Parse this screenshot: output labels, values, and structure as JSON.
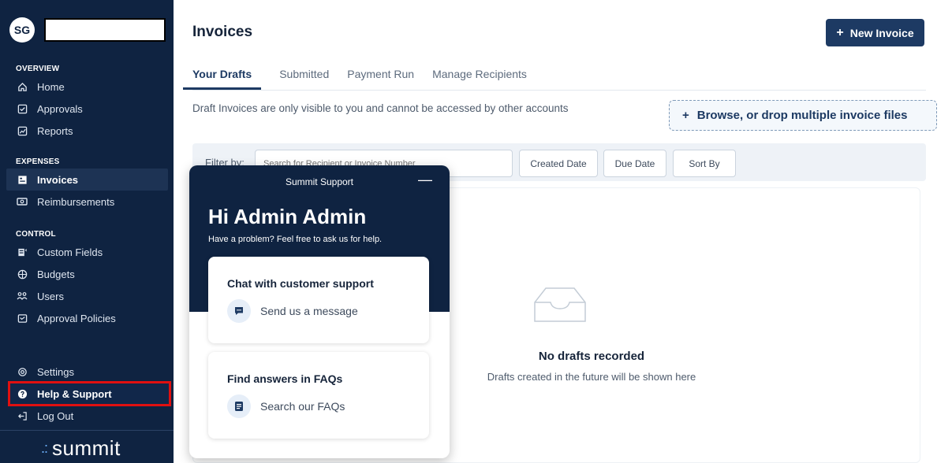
{
  "sidebar": {
    "avatar_initials": "SG",
    "sections": [
      {
        "heading": "OVERVIEW",
        "items": [
          {
            "label": "Home",
            "icon": "home-icon"
          },
          {
            "label": "Approvals",
            "icon": "check-square-icon"
          },
          {
            "label": "Reports",
            "icon": "chart-icon"
          }
        ]
      },
      {
        "heading": "EXPENSES",
        "items": [
          {
            "label": "Invoices",
            "icon": "invoice-icon"
          },
          {
            "label": "Reimbursements",
            "icon": "cash-icon"
          }
        ]
      },
      {
        "heading": "CONTROL",
        "items": [
          {
            "label": "Custom Fields",
            "icon": "fields-icon"
          },
          {
            "label": "Budgets",
            "icon": "budget-icon"
          },
          {
            "label": "Users",
            "icon": "users-icon"
          },
          {
            "label": "Approval Policies",
            "icon": "policy-icon"
          }
        ]
      }
    ],
    "bottom": {
      "settings": "Settings",
      "help": "Help & Support",
      "logout": "Log Out"
    },
    "logo_text": "summit"
  },
  "header": {
    "title": "Invoices",
    "new_invoice_label": "New Invoice"
  },
  "tabs": [
    "Your Drafts",
    "Submitted",
    "Payment Run",
    "Manage Recipients"
  ],
  "notice": "Draft Invoices are only visible to you and cannot be accessed by other accounts",
  "drop_label": "Browse, or drop multiple invoice files",
  "filter": {
    "label": "Filter by:",
    "search_placeholder": "Search for Recipient or Invoice Number",
    "created_date": "Created Date",
    "due_date": "Due Date",
    "sort_by": "Sort By"
  },
  "empty": {
    "title": "No drafts recorded",
    "subtitle": "Drafts created in the future will be shown here"
  },
  "support": {
    "title": "Summit Support",
    "greeting": "Hi Admin Admin",
    "subtitle": "Have a problem? Feel free to ask us for help.",
    "chat_title": "Chat with customer support",
    "chat_action": "Send us a message",
    "faq_title": "Find answers in FAQs",
    "faq_action": "Search our FAQs"
  },
  "colors": {
    "sidebar_bg": "#0f2341",
    "accent": "#1d3a63",
    "highlight_border": "#e01010"
  }
}
